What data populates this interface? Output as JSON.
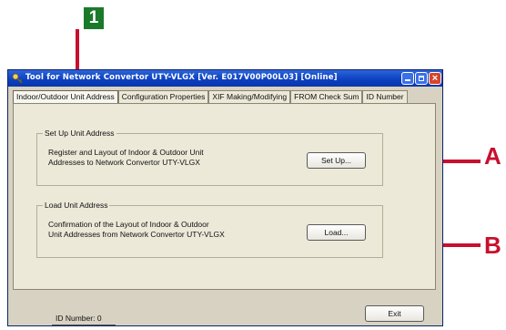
{
  "callouts": {
    "step": "1",
    "a": "A",
    "b": "B"
  },
  "colors": {
    "callout_red": "#c8102e",
    "step_green": "#1a7a2a",
    "titlebar_blue": "#0b3fc0"
  },
  "window": {
    "title": "Tool for Network Convertor UTY-VLGX [Ver. E017V00P00L03] [Online]",
    "controls": {
      "close": "×"
    }
  },
  "tabs": [
    {
      "label": "Indoor/Outdoor Unit Address",
      "active": true
    },
    {
      "label": "Configuration Properties"
    },
    {
      "label": "XIF Making/Modifying"
    },
    {
      "label": "FROM Check Sum"
    },
    {
      "label": "ID Number"
    }
  ],
  "groups": {
    "setup": {
      "legend": "Set Up Unit Address",
      "line1": "Register and Layout of Indoor & Outdoor Unit",
      "line2": "Addresses to Network Convertor UTY-VLGX",
      "button": "Set Up..."
    },
    "load": {
      "legend": "Load Unit Address",
      "line1": "Confirmation of the Layout of Indoor & Outdoor",
      "line2": "Unit Addresses from Network Convertor UTY-VLGX",
      "button": "Load..."
    }
  },
  "footer": {
    "id_number": "ID Number:  0",
    "exit": "Exit"
  },
  "icons": {
    "app": "key-icon"
  }
}
